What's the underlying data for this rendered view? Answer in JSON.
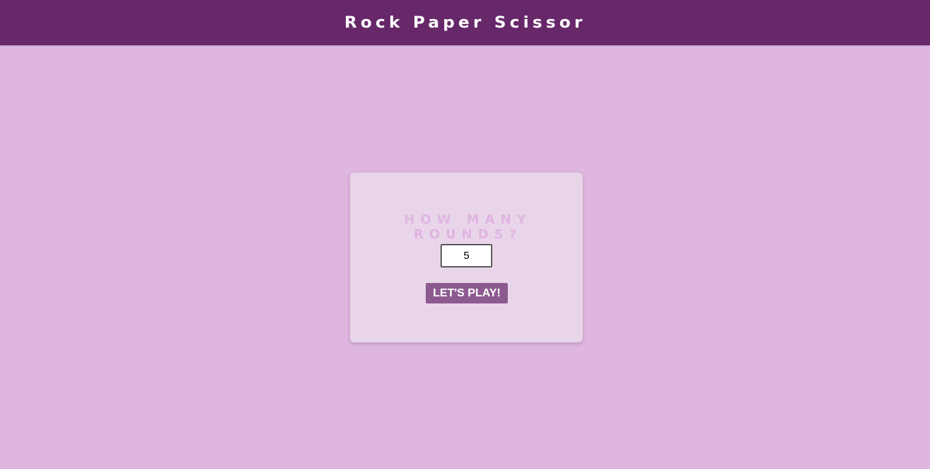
{
  "header": {
    "title": "Rock Paper Scissor"
  },
  "setup": {
    "question": "HOW MANY ROUNDS?",
    "rounds_value": "5",
    "play_label": "LET'S PLAY!"
  },
  "colors": {
    "page_background": "#dfb6e0",
    "header_background": "#67286a",
    "card_background": "#e9d5e9",
    "button_background": "#8d5a90",
    "question_color": "#e0b4e2"
  }
}
